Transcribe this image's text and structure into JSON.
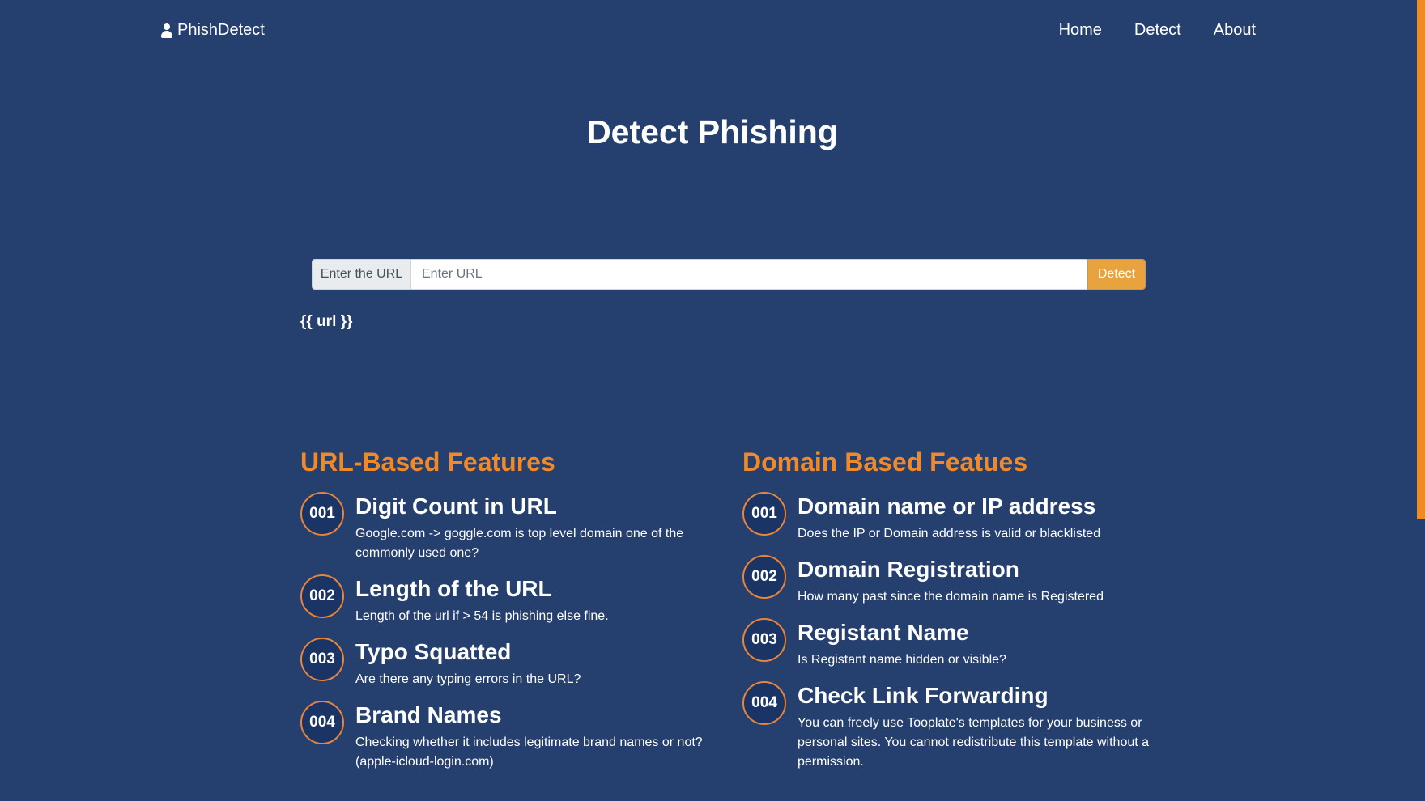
{
  "nav": {
    "brand": "PhishDetect",
    "links": [
      "Home",
      "Detect",
      "About"
    ]
  },
  "hero": {
    "title": "Detect Phishing"
  },
  "search": {
    "prepend_label": "Enter the URL",
    "placeholder": "Enter URL",
    "button_label": "Detect"
  },
  "result": {
    "text": "{{ url }}"
  },
  "url_features": {
    "heading": "URL-Based Features",
    "items": [
      {
        "num": "001",
        "title": "Digit Count in URL",
        "desc": "Google.com -> goggle.com is top level domain one of the commonly used one?"
      },
      {
        "num": "002",
        "title": "Length of the URL",
        "desc": "Length of the url if > 54 is phishing else fine."
      },
      {
        "num": "003",
        "title": "Typo Squatted",
        "desc": "Are there any typing errors in the URL?"
      },
      {
        "num": "004",
        "title": "Brand Names",
        "desc": "Checking whether it includes legitimate brand names or not? (apple-icloud-login.com)"
      }
    ]
  },
  "domain_features": {
    "heading": "Domain Based Featues",
    "items": [
      {
        "num": "001",
        "title": "Domain name or IP address",
        "desc": "Does the IP or Domain address is valid or blacklisted"
      },
      {
        "num": "002",
        "title": "Domain Registration",
        "desc": "How many past since the domain name is Registered"
      },
      {
        "num": "003",
        "title": "Registant Name",
        "desc": "Is Registant name hidden or visible?"
      },
      {
        "num": "004",
        "title": "Check Link Forwarding",
        "desc": "You can freely use Tooplate's templates for your business or personal sites. You cannot redistribute this template without a permission."
      }
    ]
  },
  "colors": {
    "background": "#253f6e",
    "accent": "#f0892a",
    "button": "#e8a23e"
  }
}
